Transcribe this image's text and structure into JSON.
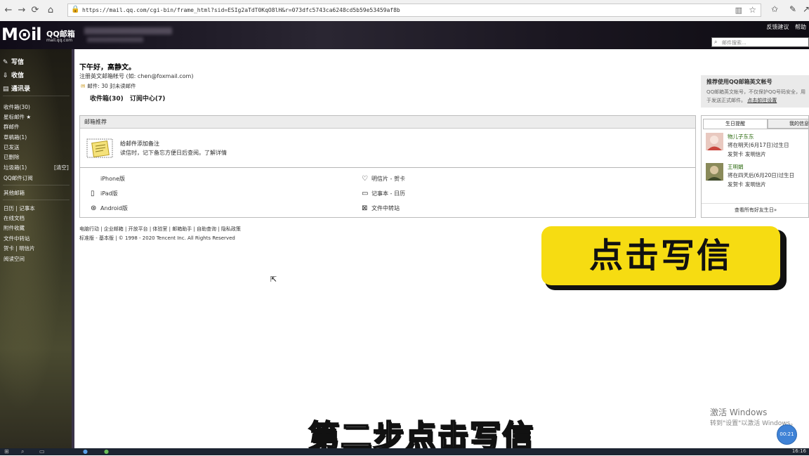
{
  "browser": {
    "url": "https://mail.qq.com/cgi-bin/frame_html?sid=ESIg2aTdT0KqO8lH&r=073dfc5743ca6248cd5b59e53459af8b",
    "back_icon": "arrow-left-icon",
    "forward_icon": "arrow-right-icon",
    "reload_icon": "reload-icon",
    "home_icon": "home-icon"
  },
  "header": {
    "logo_text": "M⊙il",
    "logo_cn": "QQ邮箱",
    "logo_domain": "mail.qq.com",
    "links": [
      "反馈建议",
      "帮助"
    ],
    "search_placeholder": "邮件搜索..."
  },
  "sidebar": {
    "main_buttons": [
      {
        "label": "写信",
        "icon": "pencil-icon"
      },
      {
        "label": "收信",
        "icon": "inbox-icon"
      },
      {
        "label": "通讯录",
        "icon": "contacts-icon"
      }
    ],
    "folders": [
      {
        "label": "收件箱(30)"
      },
      {
        "label": "星标邮件 ★"
      },
      {
        "label": "群邮件"
      },
      {
        "label": "草稿箱(1)"
      },
      {
        "label": "已发送"
      },
      {
        "label": "已删除"
      },
      {
        "label": "垃圾箱(1)",
        "extra": "[清空]"
      },
      {
        "label": "QQ邮件订阅"
      }
    ],
    "other": "其他邮箱",
    "tools": [
      {
        "label": "日历",
        "extra": "记事本"
      },
      {
        "label": "在线文档"
      },
      {
        "label": "附件收藏"
      },
      {
        "label": "文件中转站"
      },
      {
        "label": "贺卡",
        "extra": "明信片"
      },
      {
        "label": "阅读空间"
      }
    ]
  },
  "content": {
    "greeting": "下午好，高静文。",
    "register": "注册英文邮箱帐号 (如: chen@foxmail.com)",
    "mail_count": "邮件: 30 封未读邮件",
    "quick_links": [
      "收件箱(30)",
      "订阅中心(7)"
    ],
    "panel_title": "邮箱推荐",
    "note_title": "给邮件添加备注",
    "note_desc": "读信时，记下备忘方便日后查阅。了解详情",
    "apps": [
      {
        "label": "iPhone版",
        "icon": "apple-icon"
      },
      {
        "label": "iPad版",
        "icon": "tablet-icon"
      },
      {
        "label": "Android版",
        "icon": "android-icon"
      },
      {
        "label": "明信片 - 贺卡",
        "icon": "heart-icon"
      },
      {
        "label": "记事本 - 日历",
        "icon": "calendar-icon"
      },
      {
        "label": "文件中转站",
        "icon": "transfer-icon"
      }
    ]
  },
  "promo": {
    "title": "推荐使用QQ邮箱英文帐号",
    "desc": "QQ邮箱英文帐号，不仅保护QQ号码安全，用于发送正式邮件。",
    "link": "点击前往设置"
  },
  "birthday": {
    "tab_active": "生日提醒",
    "tab_other": "我的信息",
    "people": [
      {
        "name": "物儿子东东",
        "date": "将在明天(6月17日)过生日",
        "actions": "发贺卡  发明信片"
      },
      {
        "name": "王明娟",
        "date": "将在四天后(6月20日)过生日",
        "actions": "发贺卡  发明信片"
      }
    ],
    "more": "查看所有好友生日»"
  },
  "footer": {
    "links": "电脑行动 | 企业邮箱 | 开放平台 | 体验室 | 邮箱助手 | 自助查询 | 隐私政策",
    "copyright": "标准版 - 基本版 | © 1998 - 2020 Tencent Inc. All Rights Reserved"
  },
  "overlay": {
    "button_text": "点击写信",
    "subtitle": "第二步点击写信",
    "activate_title": "激活 Windows",
    "activate_desc": "转到\"设置\"以激活 Windows。",
    "bubble": "00:21"
  },
  "taskbar": {
    "time": "16:16"
  },
  "colors": {
    "accent_yellow": "#f6dc12",
    "header_dark": "#1a1620",
    "sidebar_olive": "#3a3a26"
  }
}
